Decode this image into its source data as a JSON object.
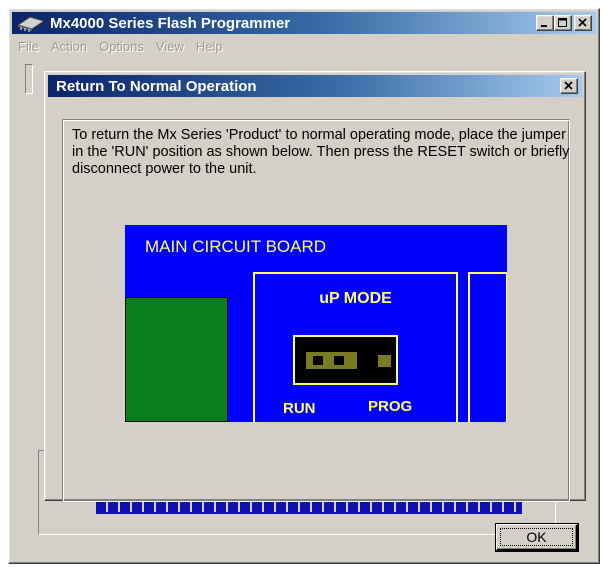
{
  "main_window": {
    "title": "Mx4000 Series Flash Programmer",
    "icon": "chip-icon",
    "menu": [
      {
        "label": "File"
      },
      {
        "label": "Action"
      },
      {
        "label": "Options"
      },
      {
        "label": "View"
      },
      {
        "label": "Help"
      }
    ]
  },
  "dialog": {
    "title": "Return To Normal Operation",
    "message": "To return the Mx Series 'Product' to normal operating mode, place the jumper in the 'RUN' position as shown below. Then press the RESET switch or briefly disconnect power to the unit.",
    "ok_label": "OK"
  },
  "diagram": {
    "board_title": "MAIN CIRCUIT BOARD",
    "mode_label": "uP MODE",
    "run_label": "RUN",
    "prog_label": "PROG"
  },
  "colors": {
    "board": "#0000ff",
    "label_yellow": "#ffff66",
    "chip_green": "#0a7d1e",
    "jumper": "#7a7a1e",
    "titlebar_start": "#0a246a"
  }
}
